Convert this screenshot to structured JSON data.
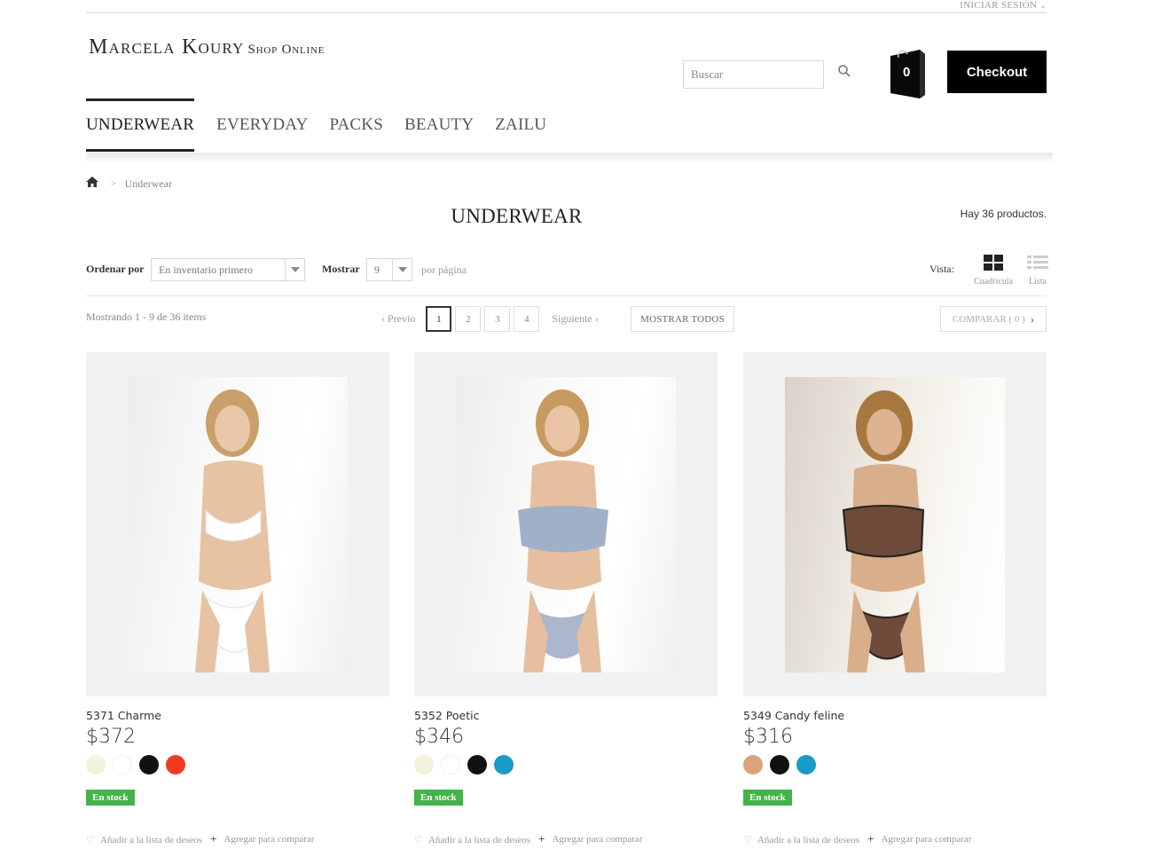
{
  "topbar": {
    "login_label": "INICIAR SESIÓN",
    "caret": "⌄"
  },
  "logo": {
    "brand": "Marcela Koury",
    "tagline": "Shop Online"
  },
  "search": {
    "placeholder": "Buscar",
    "value": ""
  },
  "cart": {
    "count": "0"
  },
  "checkout_label": "Checkout",
  "nav": {
    "items": [
      {
        "label": "UNDERWEAR"
      },
      {
        "label": "EVERYDAY"
      },
      {
        "label": "PACKS"
      },
      {
        "label": "BEAUTY"
      },
      {
        "label": "ZAILU"
      }
    ]
  },
  "breadcrumb": {
    "separator": ">",
    "current": "Underwear"
  },
  "page": {
    "title": "UNDERWEAR",
    "count_text": "Hay 36 productos."
  },
  "sortbar": {
    "sort_label": "Ordenar por",
    "sort_value": "En inventario primero",
    "show_label": "Mostrar",
    "show_value": "9",
    "per_page": "por página",
    "view_label": "Vista:",
    "view_grid": "Cuadrícula",
    "view_list": "Lista"
  },
  "pagination": {
    "showing": "Mostrando 1 - 9 de 36 items",
    "prev": "Previo",
    "pages": [
      "1",
      "2",
      "3",
      "4"
    ],
    "next": "Siguiente",
    "show_all": "MOSTRAR TODOS",
    "compare": "COMPARAR ( 0 )"
  },
  "colors": {
    "accent": "#000000",
    "stock_green": "#45b348"
  },
  "products": [
    {
      "name": "5371 Charme",
      "price": "$372",
      "swatches": [
        "#f3f2dc",
        "#ffffff",
        "#111111",
        "#f23a22"
      ],
      "stock": "En stock",
      "wishlist": "Añadir a la lista de deseos",
      "compare": "Agregar para comparar",
      "garment": "#ffffff"
    },
    {
      "name": "5352 Poetic",
      "price": "$346",
      "swatches": [
        "#f3f2dc",
        "#ffffff",
        "#111111",
        "#1a9bc4"
      ],
      "stock": "En stock",
      "wishlist": "Añadir a la lista de deseos",
      "compare": "Agregar para comparar",
      "garment": "#9fb0c8"
    },
    {
      "name": "5349 Candy feline",
      "price": "$316",
      "swatches": [
        "#d9a47c",
        "#111111",
        "#1a9bc4"
      ],
      "stock": "En stock",
      "wishlist": "Añadir a la lista de deseos",
      "compare": "Agregar para comparar",
      "garment": "#6d4a3a"
    }
  ]
}
